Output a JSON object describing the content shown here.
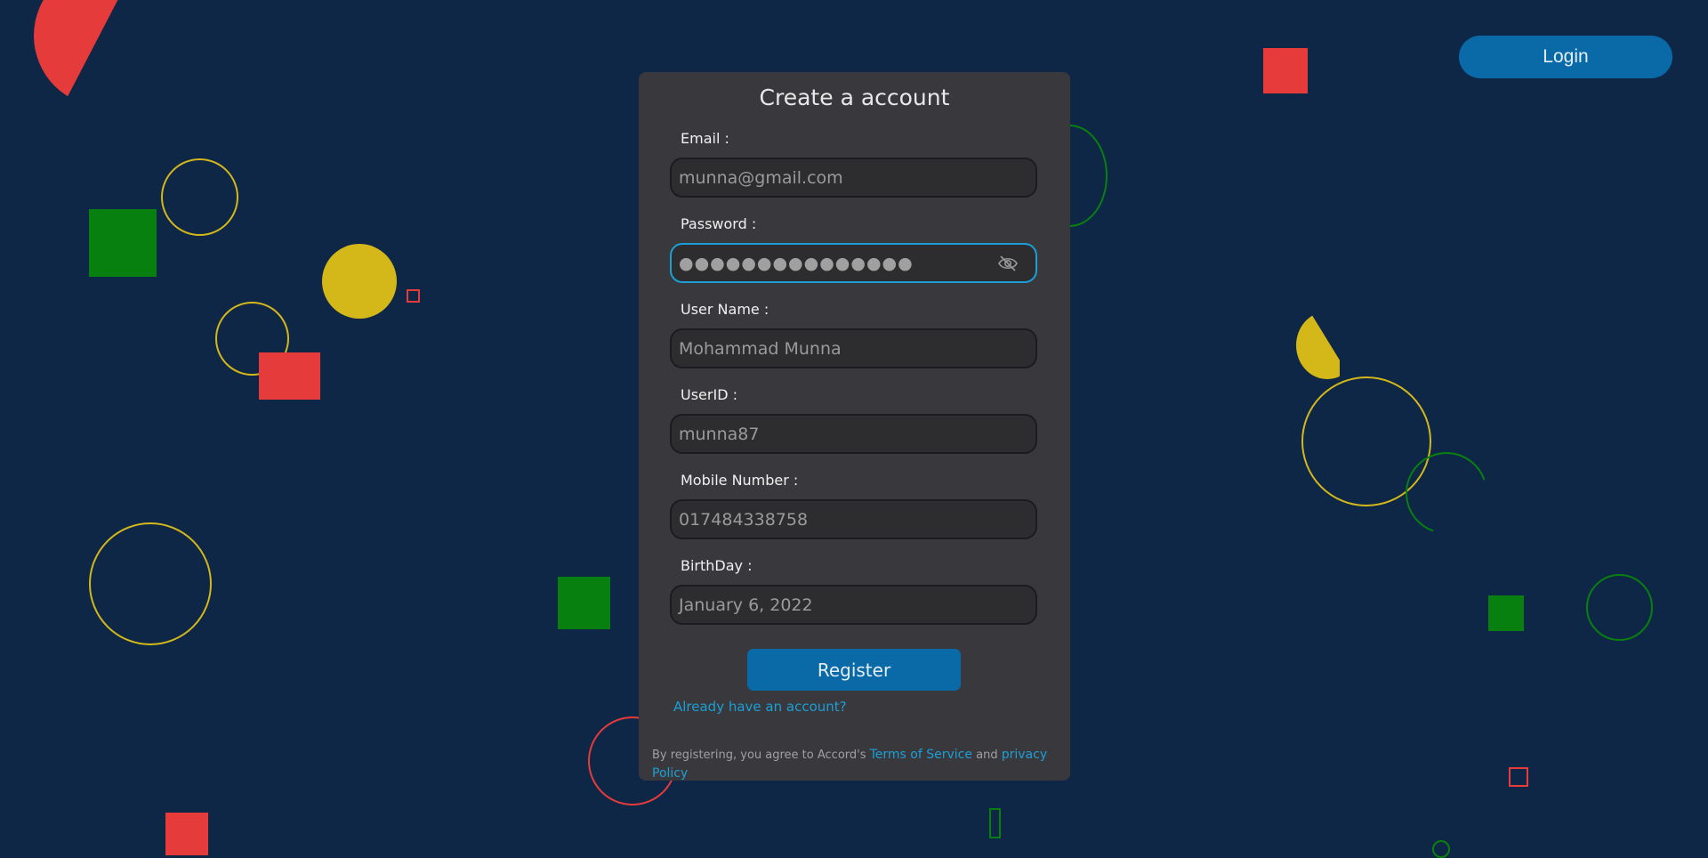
{
  "header": {
    "login_label": "Login"
  },
  "form": {
    "title": "Create a account",
    "email": {
      "label": "Email :",
      "value": "munna@gmail.com"
    },
    "password": {
      "label": "Password :",
      "value": "●●●●●●●●●●●●●●●"
    },
    "username": {
      "label": "User Name :",
      "value": "Mohammad Munna"
    },
    "userid": {
      "label": "UserID :",
      "value": "munna87"
    },
    "mobile": {
      "label": "Mobile Number :",
      "value": "017484338758"
    },
    "birthday": {
      "label": "BirthDay :",
      "value": "January 6, 2022"
    },
    "register_label": "Register",
    "already_label": "Already have an account?",
    "terms": {
      "prefix": "By registering, you agree to Accord's ",
      "tos_label": "Terms of Service",
      "and": " and ",
      "privacy_label": "privacy Policy"
    }
  },
  "icons": {
    "password_toggle": "eye-off-icon"
  },
  "colors": {
    "background": "#0f2747",
    "card": "#39393d",
    "accent": "#0a6aa8",
    "link": "#1b9fd6",
    "deco_red": "#e63b3b",
    "deco_yellow": "#d4b81a",
    "deco_green": "#08800f"
  }
}
